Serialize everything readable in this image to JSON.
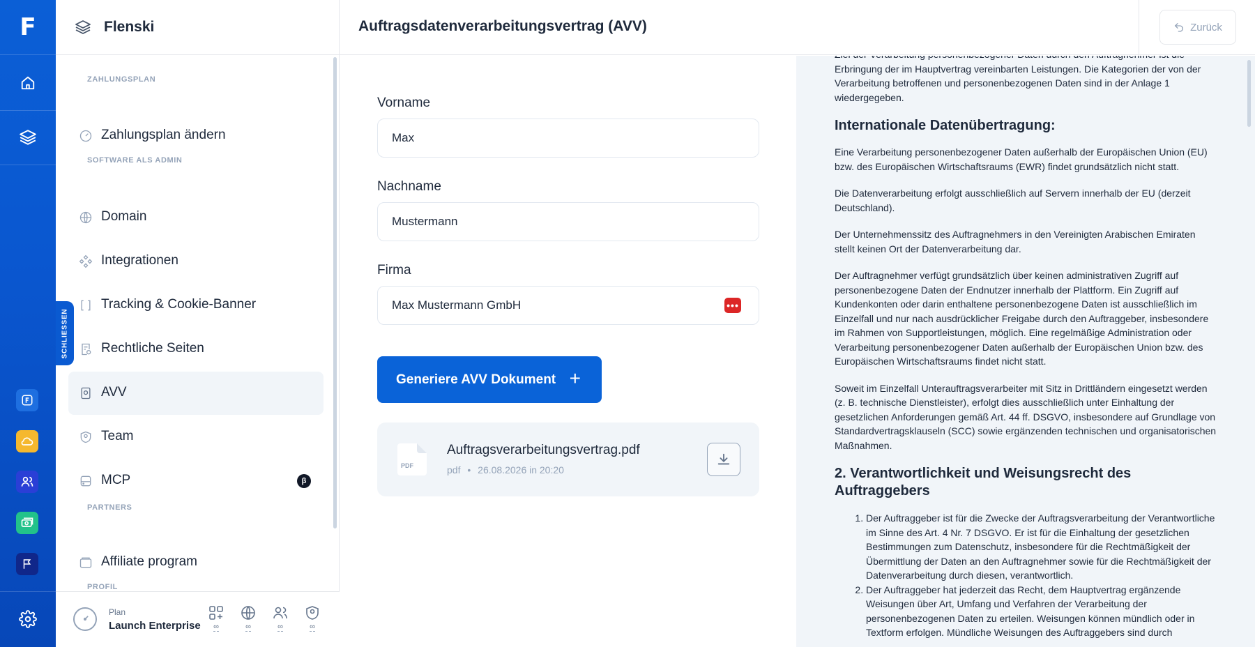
{
  "rail": {
    "logo_letter": "F",
    "apps": [
      {
        "name": "flenski-app",
        "color": "#1e6fe0"
      },
      {
        "name": "cloud-app",
        "color": "#f5b82e"
      },
      {
        "name": "users-app",
        "color": "#2a3fd6"
      },
      {
        "name": "money-app",
        "color": "#22c28a"
      },
      {
        "name": "flag-app",
        "color": "#10278a"
      }
    ]
  },
  "sidebar": {
    "brand": "Flenski",
    "sections": {
      "billing": "ZAHLUNGSPLAN",
      "admin": "SOFTWARE ALS ADMIN",
      "partners": "PARTNERS",
      "profile": "PROFIL"
    },
    "items": {
      "change_plan": "Zahlungsplan ändern",
      "domain": "Domain",
      "integrations": "Integrationen",
      "tracking": "Tracking & Cookie-Banner",
      "legal": "Rechtliche Seiten",
      "avv": "AVV",
      "team": "Team",
      "mcp": "MCP",
      "mcp_badge": "β",
      "affiliate": "Affiliate program"
    },
    "close_tab": "SCHLIESSEN",
    "footer": {
      "plan_label": "Plan",
      "plan_value": "Launch Enterprise",
      "feature_icons": [
        "apps-icon",
        "globe-icon",
        "team-icon",
        "shield-icon"
      ],
      "feature_value": "∞"
    }
  },
  "topbar": {
    "title": "Auftragsdatenverarbeitungsvertrag (AVV)",
    "back_label": "Zurück"
  },
  "form": {
    "first_name_label": "Vorname",
    "first_name_value": "Max",
    "last_name_label": "Nachname",
    "last_name_value": "Mustermann",
    "company_label": "Firma",
    "company_value": "Max Mustermann GmbH",
    "generate_label": "Generiere AVV Dokument",
    "file": {
      "type_label": "PDF",
      "name": "Auftragsverarbeitungsvertrag.pdf",
      "ext": "pdf",
      "date": "26.08.2026 in 20:20"
    }
  },
  "document": {
    "intro": "Ziel der Verarbeitung personenbezogener Daten durch den Auftragnehmer ist die Erbringung der im Hauptvertrag vereinbarten Leistungen. Die Kategorien der von der Verarbeitung betroffenen und personenbezogenen Daten sind in der Anlage 1 wiedergegeben.",
    "h_international": "Internationale Datenübertragung:",
    "p1": "Eine Verarbeitung personenbezogener Daten außerhalb der Europäischen Union (EU) bzw. des Europäischen Wirtschaftsraums (EWR) findet grundsätzlich nicht statt.",
    "p2": "Die Datenverarbeitung erfolgt ausschließlich auf Servern innerhalb der EU (derzeit Deutschland).",
    "p3": "Der Unternehmenssitz des Auftragnehmers in den Vereinigten Arabischen Emiraten stellt keinen Ort der Datenverarbeitung dar.",
    "p4": "Der Auftragnehmer verfügt grundsätzlich über keinen administrativen Zugriff auf personenbezogene Daten der Endnutzer innerhalb der Plattform. Ein Zugriff auf Kundenkonten oder darin enthaltene personenbezogene Daten ist ausschließlich im Einzelfall und nur nach ausdrücklicher Freigabe durch den Auftraggeber, insbesondere im Rahmen von Supportleistungen, möglich. Eine regelmäßige Administration oder Verarbeitung personenbezogener Daten außerhalb der Europäischen Union bzw. des Europäischen Wirtschaftsraums findet nicht statt.",
    "p5": "Soweit im Einzelfall Unterauftragsverarbeiter mit Sitz in Drittländern eingesetzt werden (z. B. technische Dienstleister), erfolgt dies ausschließlich unter Einhaltung der gesetzlichen Anforderungen gemäß Art. 44 ff. DSGVO, insbesondere auf Grundlage von Standardvertragsklauseln (SCC) sowie ergänzenden technischen und organisatorischen Maßnahmen.",
    "h_section2": "2. Verantwortlichkeit und Weisungsrecht des Auftraggebers",
    "li1": "Der Auftraggeber ist für die Zwecke der Auftragsverarbeitung der Verantwortliche im Sinne des Art. 4 Nr. 7 DSGVO. Er ist für die Einhaltung der gesetzlichen Bestimmungen zum Datenschutz, insbesondere für die Rechtmäßigkeit der Übermittlung der Daten an den Auftragnehmer sowie für die Rechtmäßigkeit der Datenverarbeitung durch diesen, verantwortlich.",
    "li2": "Der Auftraggeber hat jederzeit das Recht, dem Hauptvertrag ergänzende Weisungen über Art, Umfang und Verfahren der Verarbeitung der personenbezogenen Daten zu erteilen. Weisungen können mündlich oder in Textform erfolgen. Mündliche Weisungen des Auftraggebers sind durch"
  }
}
